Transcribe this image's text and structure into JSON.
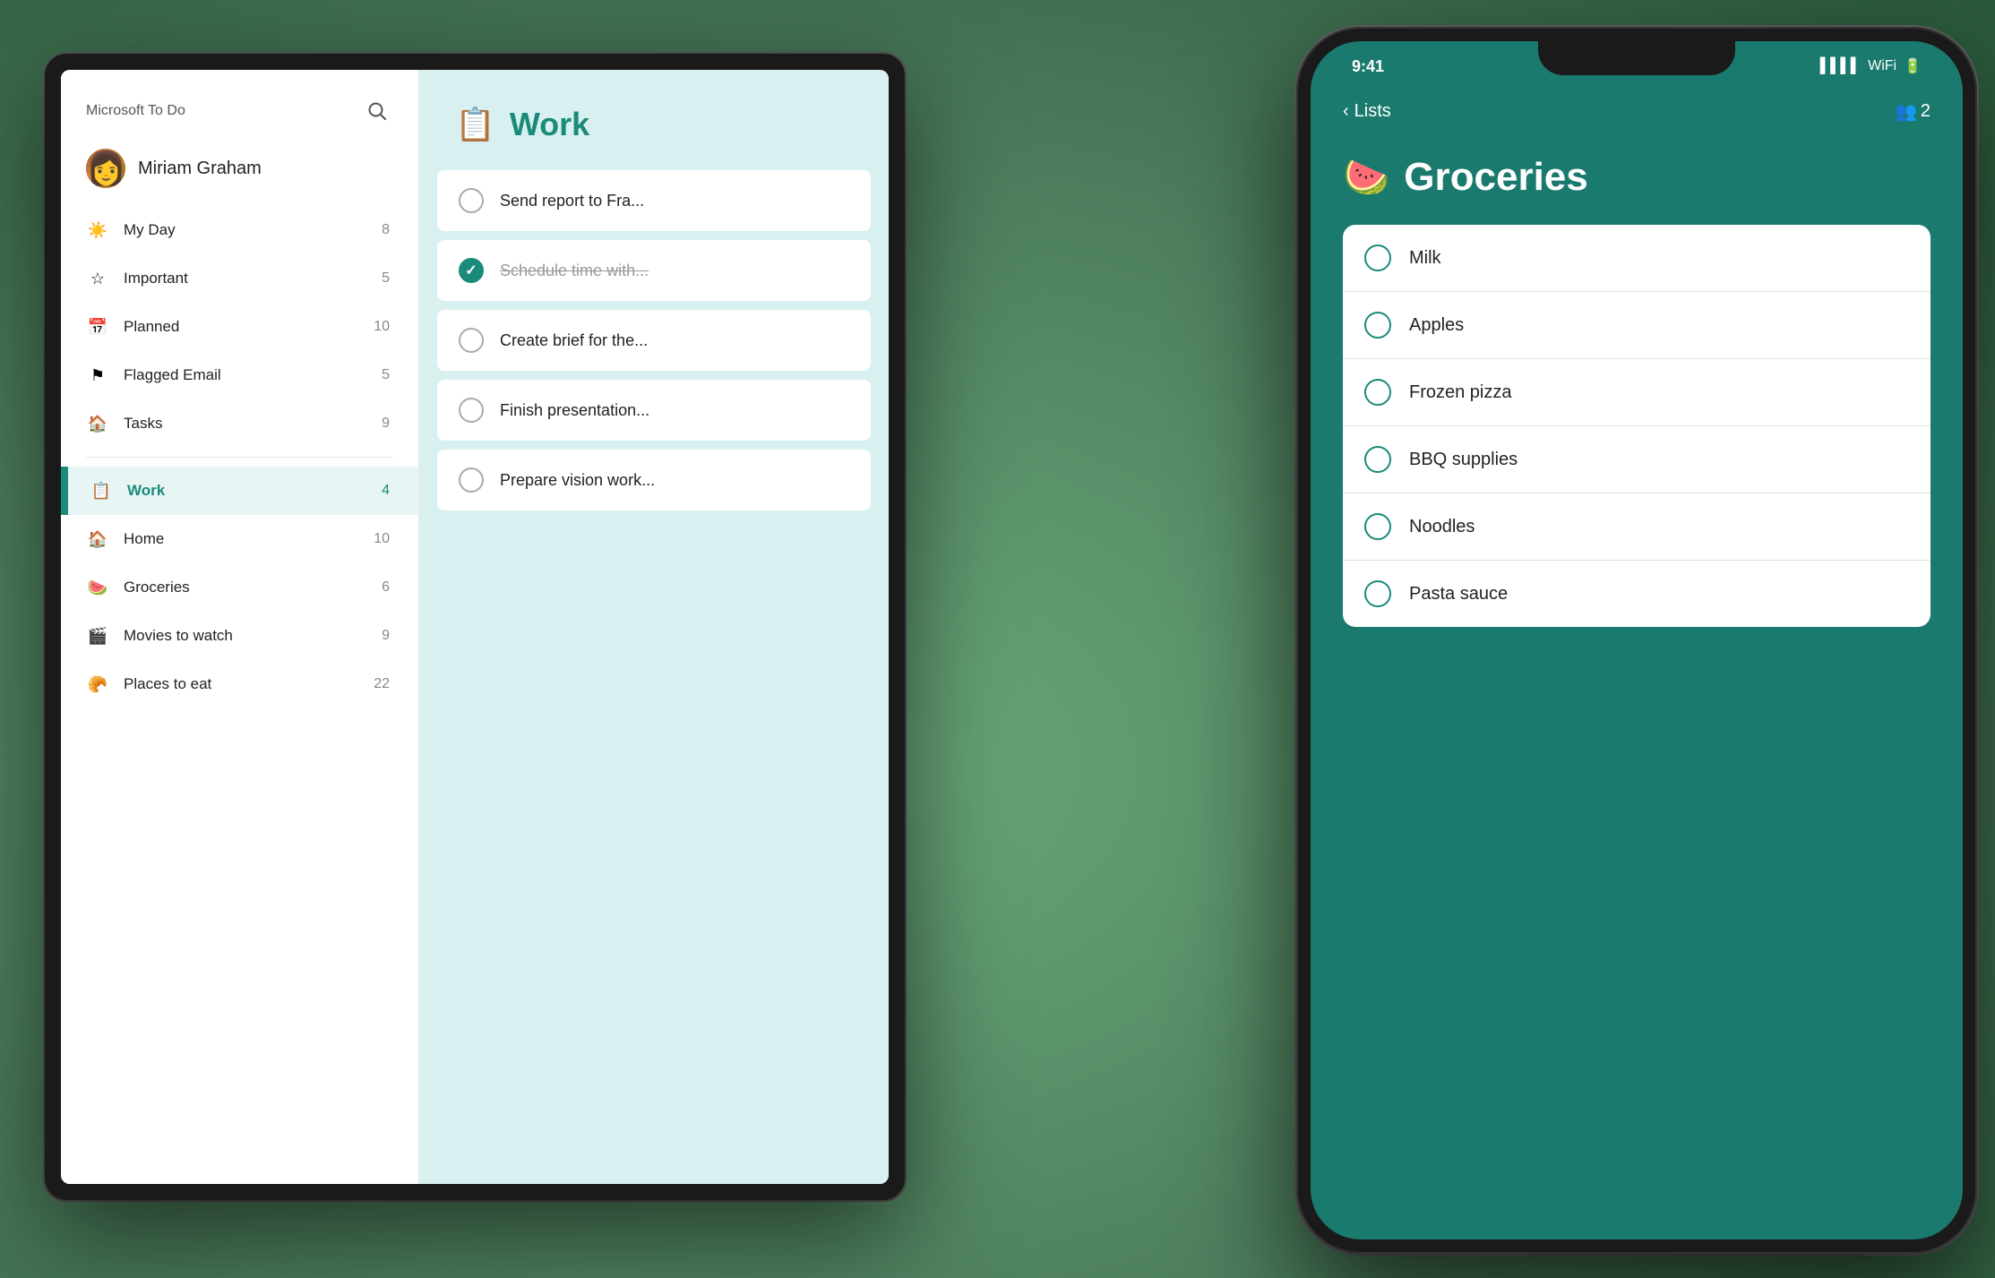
{
  "app": {
    "title": "Microsoft To Do"
  },
  "sidebar": {
    "user_name": "Miriam Graham",
    "nav_items": [
      {
        "id": "my-day",
        "label": "My Day",
        "count": "8",
        "icon": "☀",
        "active": false
      },
      {
        "id": "important",
        "label": "Important",
        "count": "5",
        "icon": "☆",
        "active": false
      },
      {
        "id": "planned",
        "label": "Planned",
        "count": "10",
        "icon": "▦",
        "active": false
      },
      {
        "id": "flagged-email",
        "label": "Flagged Email",
        "count": "5",
        "icon": "⚑",
        "active": false
      },
      {
        "id": "tasks",
        "label": "Tasks",
        "count": "9",
        "icon": "⌂",
        "active": false
      },
      {
        "id": "work",
        "label": "Work",
        "count": "4",
        "icon": "📋",
        "active": true
      },
      {
        "id": "home",
        "label": "Home",
        "count": "10",
        "icon": "🏠",
        "active": false
      },
      {
        "id": "groceries",
        "label": "Groceries",
        "count": "6",
        "icon": "🍉",
        "active": false
      },
      {
        "id": "movies",
        "label": "Movies to watch",
        "count": "9",
        "icon": "🎬",
        "active": false
      },
      {
        "id": "places",
        "label": "Places to eat",
        "count": "22",
        "icon": "🥐",
        "active": false
      }
    ]
  },
  "work_list": {
    "title": "Work",
    "emoji": "📋",
    "tasks": [
      {
        "id": "t1",
        "text": "Send report to Fra...",
        "completed": false
      },
      {
        "id": "t2",
        "text": "Schedule time with...",
        "completed": true
      },
      {
        "id": "t3",
        "text": "Create brief for the...",
        "completed": false
      },
      {
        "id": "t4",
        "text": "Finish presentation...",
        "completed": false
      },
      {
        "id": "t5",
        "text": "Prepare vision work...",
        "completed": false
      }
    ]
  },
  "phone": {
    "status_time": "9:41",
    "nav_back_label": "Lists",
    "nav_action_count": "2",
    "groceries_list": {
      "title": "Groceries",
      "emoji": "🍉",
      "items": [
        {
          "id": "g1",
          "text": "Milk"
        },
        {
          "id": "g2",
          "text": "Apples"
        },
        {
          "id": "g3",
          "text": "Frozen pizza"
        },
        {
          "id": "g4",
          "text": "BBQ supplies"
        },
        {
          "id": "g5",
          "text": "Noodles"
        },
        {
          "id": "g6",
          "text": "Pasta sauce"
        }
      ]
    }
  }
}
